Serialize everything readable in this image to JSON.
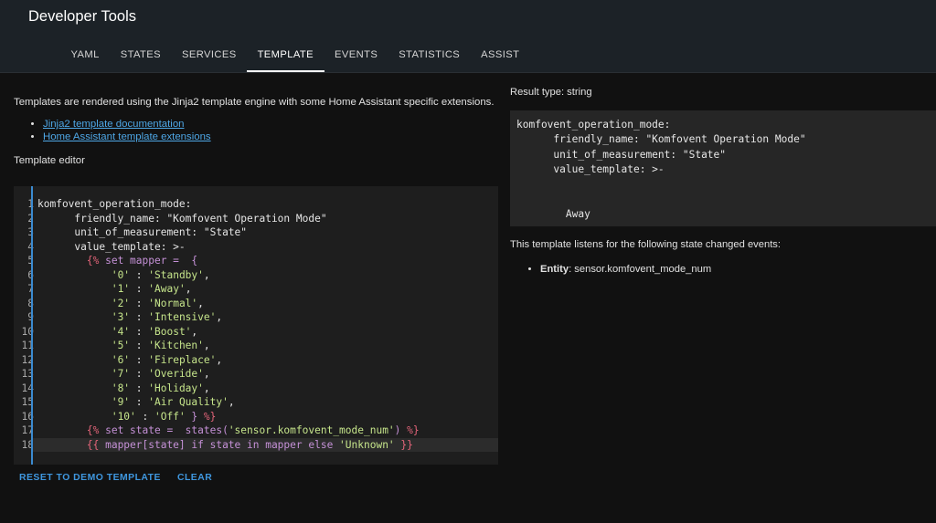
{
  "header": {
    "title": "Developer Tools",
    "tabs": [
      {
        "label": "YAML"
      },
      {
        "label": "STATES"
      },
      {
        "label": "SERVICES"
      },
      {
        "label": "TEMPLATE",
        "active": true
      },
      {
        "label": "EVENTS"
      },
      {
        "label": "STATISTICS"
      },
      {
        "label": "ASSIST"
      }
    ]
  },
  "intro": {
    "text": "Templates are rendered using the Jinja2 template engine with some Home Assistant specific extensions.",
    "links": [
      "Jinja2 template documentation",
      "Home Assistant template extensions"
    ]
  },
  "editor": {
    "label": "Template editor",
    "line_numbers": [
      "1",
      "2",
      "3",
      "4",
      "5",
      "6",
      "7",
      "8",
      "9",
      "10",
      "11",
      "12",
      "13",
      "14",
      "15",
      "16",
      "17",
      "18"
    ],
    "lines": [
      [
        {
          "t": "komfovent_operation_mode:",
          "c": "key"
        }
      ],
      [
        {
          "t": "      friendly_name: \"Komfovent Operation Mode\"",
          "c": "key"
        }
      ],
      [
        {
          "t": "      unit_of_measurement: \"State\"",
          "c": "key"
        }
      ],
      [
        {
          "t": "      value_template: >-",
          "c": "key"
        }
      ],
      [
        {
          "t": "        {% ",
          "c": "tag"
        },
        {
          "t": "set mapper =  {",
          "c": "var"
        }
      ],
      [
        {
          "t": "            ",
          "c": "key"
        },
        {
          "t": "'0'",
          "c": "str"
        },
        {
          "t": " : ",
          "c": "key"
        },
        {
          "t": "'Standby'",
          "c": "str"
        },
        {
          "t": ",",
          "c": "key"
        }
      ],
      [
        {
          "t": "            ",
          "c": "key"
        },
        {
          "t": "'1'",
          "c": "str"
        },
        {
          "t": " : ",
          "c": "key"
        },
        {
          "t": "'Away'",
          "c": "str"
        },
        {
          "t": ",",
          "c": "key"
        }
      ],
      [
        {
          "t": "            ",
          "c": "key"
        },
        {
          "t": "'2'",
          "c": "str"
        },
        {
          "t": " : ",
          "c": "key"
        },
        {
          "t": "'Normal'",
          "c": "str"
        },
        {
          "t": ",",
          "c": "key"
        }
      ],
      [
        {
          "t": "            ",
          "c": "key"
        },
        {
          "t": "'3'",
          "c": "str"
        },
        {
          "t": " : ",
          "c": "key"
        },
        {
          "t": "'Intensive'",
          "c": "str"
        },
        {
          "t": ",",
          "c": "key"
        }
      ],
      [
        {
          "t": "            ",
          "c": "key"
        },
        {
          "t": "'4'",
          "c": "str"
        },
        {
          "t": " : ",
          "c": "key"
        },
        {
          "t": "'Boost'",
          "c": "str"
        },
        {
          "t": ",",
          "c": "key"
        }
      ],
      [
        {
          "t": "            ",
          "c": "key"
        },
        {
          "t": "'5'",
          "c": "str"
        },
        {
          "t": " : ",
          "c": "key"
        },
        {
          "t": "'Kitchen'",
          "c": "str"
        },
        {
          "t": ",",
          "c": "key"
        }
      ],
      [
        {
          "t": "            ",
          "c": "key"
        },
        {
          "t": "'6'",
          "c": "str"
        },
        {
          "t": " : ",
          "c": "key"
        },
        {
          "t": "'Fireplace'",
          "c": "str"
        },
        {
          "t": ",",
          "c": "key"
        }
      ],
      [
        {
          "t": "            ",
          "c": "key"
        },
        {
          "t": "'7'",
          "c": "str"
        },
        {
          "t": " : ",
          "c": "key"
        },
        {
          "t": "'Overide'",
          "c": "str"
        },
        {
          "t": ",",
          "c": "key"
        }
      ],
      [
        {
          "t": "            ",
          "c": "key"
        },
        {
          "t": "'8'",
          "c": "str"
        },
        {
          "t": " : ",
          "c": "key"
        },
        {
          "t": "'Holiday'",
          "c": "str"
        },
        {
          "t": ",",
          "c": "key"
        }
      ],
      [
        {
          "t": "            ",
          "c": "key"
        },
        {
          "t": "'9'",
          "c": "str"
        },
        {
          "t": " : ",
          "c": "key"
        },
        {
          "t": "'Air Quality'",
          "c": "str"
        },
        {
          "t": ",",
          "c": "key"
        }
      ],
      [
        {
          "t": "            ",
          "c": "key"
        },
        {
          "t": "'10'",
          "c": "str"
        },
        {
          "t": " : ",
          "c": "key"
        },
        {
          "t": "'Off'",
          "c": "str"
        },
        {
          "t": " } ",
          "c": "var"
        },
        {
          "t": "%}",
          "c": "tag"
        }
      ],
      [
        {
          "t": "        {% ",
          "c": "tag"
        },
        {
          "t": "set state =  states(",
          "c": "var"
        },
        {
          "t": "'sensor.komfovent_mode_num'",
          "c": "str"
        },
        {
          "t": ") ",
          "c": "var"
        },
        {
          "t": "%}",
          "c": "tag"
        }
      ],
      [
        {
          "t": "        {{ ",
          "c": "tag"
        },
        {
          "t": "mapper[state] if state in mapper else ",
          "c": "var"
        },
        {
          "t": "'Unknown'",
          "c": "str"
        },
        {
          "t": " }}",
          "c": "tag"
        }
      ]
    ],
    "buttons": {
      "reset": "RESET TO DEMO TEMPLATE",
      "clear": "CLEAR"
    }
  },
  "result": {
    "type_label": "Result type: string",
    "output": "komfovent_operation_mode:\n      friendly_name: \"Komfovent Operation Mode\"\n      unit_of_measurement: \"State\"\n      value_template: >-\n\n\n        Away",
    "listens_text": "This template listens for the following state changed events:",
    "entity_label": "Entity",
    "entity_value": ": sensor.komfovent_mode_num"
  },
  "colors": {
    "header_bg": "#1c2227",
    "page_bg": "#111111",
    "editor_bg": "#1e1e1e",
    "link": "#4ea7e6",
    "accent": "#3b8ad0",
    "tag": "#e5657a",
    "var": "#c591d7",
    "string": "#c6e58b"
  }
}
